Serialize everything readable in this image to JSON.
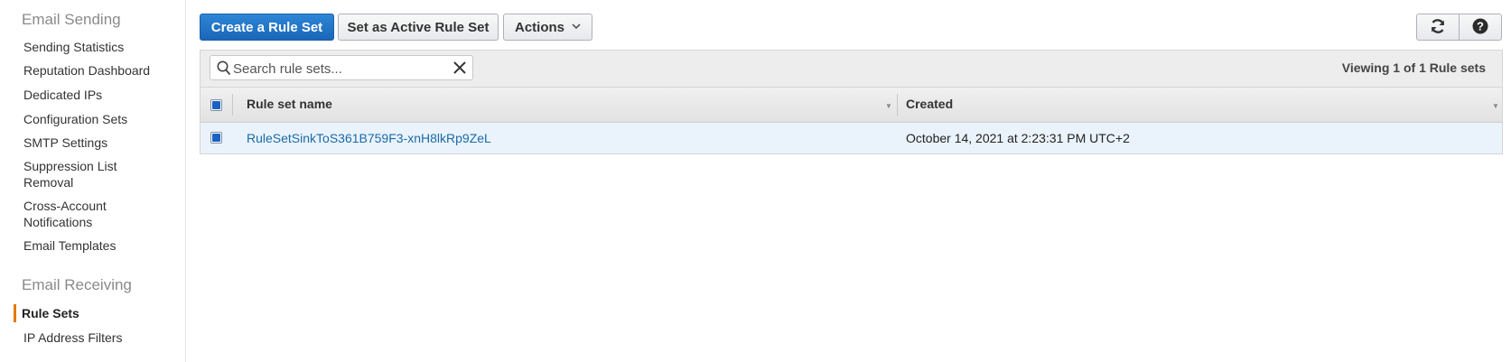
{
  "sidebar": {
    "sending_title": "Email Sending",
    "sending_items": [
      "Sending Statistics",
      "Reputation Dashboard",
      "Dedicated IPs",
      "Configuration Sets",
      "SMTP Settings",
      "Suppression List Removal",
      "Cross-Account Notifications",
      "Email Templates"
    ],
    "receiving_title": "Email Receiving",
    "receiving_items": [
      "Rule Sets",
      "IP Address Filters"
    ],
    "active_item": "Rule Sets"
  },
  "toolbar": {
    "create_label": "Create a Rule Set",
    "set_active_label": "Set as Active Rule Set",
    "actions_label": "Actions",
    "refresh_icon": "refresh-icon",
    "help_icon": "help-icon"
  },
  "search": {
    "placeholder": "Search rule sets...",
    "value": ""
  },
  "viewing_text": "Viewing 1 of 1 Rule sets",
  "table": {
    "columns": [
      "Rule set name",
      "Created"
    ],
    "rows": [
      {
        "selected": true,
        "name": "RuleSetSinkToS361B759F3-xnH8lkRp9ZeL",
        "created": "October 14, 2021 at 2:23:31 PM UTC+2"
      }
    ]
  },
  "colors": {
    "primary_button": "#1a66b8",
    "link": "#1b6aa8",
    "active_marker": "#e47911",
    "selected_row": "#eaf3fb"
  }
}
